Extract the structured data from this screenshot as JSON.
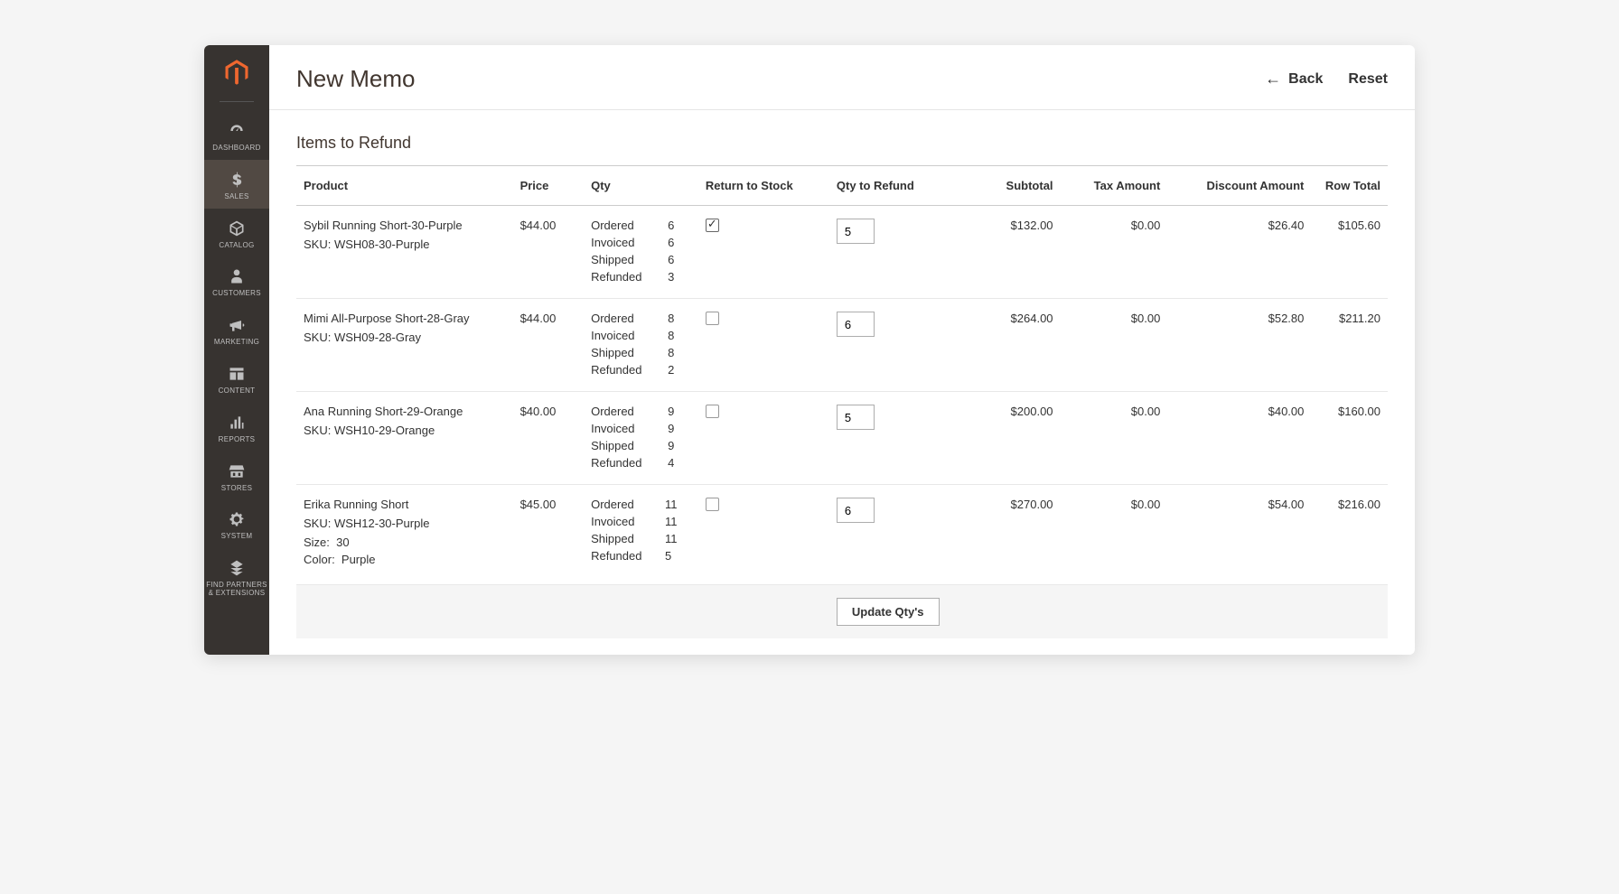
{
  "header": {
    "title": "New Memo",
    "back_label": "Back",
    "reset_label": "Reset"
  },
  "sidebar": {
    "items": [
      {
        "label": "DASHBOARD",
        "icon": "dashboard-icon"
      },
      {
        "label": "SALES",
        "icon": "dollar-icon",
        "active": true
      },
      {
        "label": "CATALOG",
        "icon": "box-icon"
      },
      {
        "label": "CUSTOMERS",
        "icon": "person-icon"
      },
      {
        "label": "MARKETING",
        "icon": "megaphone-icon"
      },
      {
        "label": "CONTENT",
        "icon": "layout-icon"
      },
      {
        "label": "REPORTS",
        "icon": "bars-icon"
      },
      {
        "label": "STORES",
        "icon": "storefront-icon"
      },
      {
        "label": "SYSTEM",
        "icon": "gear-icon"
      },
      {
        "label": "FIND PARTNERS & EXTENSIONS",
        "icon": "grid-icon"
      }
    ]
  },
  "section": {
    "title": "Items to Refund",
    "columns": {
      "product": "Product",
      "price": "Price",
      "qty": "Qty",
      "return_to_stock": "Return to Stock",
      "qty_to_refund": "Qty to Refund",
      "subtotal": "Subtotal",
      "tax_amount": "Tax Amount",
      "discount_amount": "Discount Amount",
      "row_total": "Row Total"
    },
    "qty_labels": {
      "ordered": "Ordered",
      "invoiced": "Invoiced",
      "shipped": "Shipped",
      "refunded": "Refunded"
    },
    "sku_prefix": "SKU:",
    "attr_labels": {
      "size": "Size:",
      "color": "Color:"
    },
    "update_label": "Update Qty's"
  },
  "rows": [
    {
      "name": "Sybil Running Short-30-Purple",
      "sku": "WSH08-30-Purple",
      "price": "$44.00",
      "ordered": "6",
      "invoiced": "6",
      "shipped": "6",
      "refunded": "3",
      "return_checked": true,
      "qty_to_refund": "5",
      "subtotal": "$132.00",
      "tax": "$0.00",
      "discount": "$26.40",
      "row_total": "$105.60"
    },
    {
      "name": "Mimi All-Purpose Short-28-Gray",
      "sku": "WSH09-28-Gray",
      "price": "$44.00",
      "ordered": "8",
      "invoiced": "8",
      "shipped": "8",
      "refunded": "2",
      "return_checked": false,
      "qty_to_refund": "6",
      "subtotal": "$264.00",
      "tax": "$0.00",
      "discount": "$52.80",
      "row_total": "$211.20"
    },
    {
      "name": "Ana Running Short-29-Orange",
      "sku": "WSH10-29-Orange",
      "price": "$40.00",
      "ordered": "9",
      "invoiced": "9",
      "shipped": "9",
      "refunded": "4",
      "return_checked": false,
      "qty_to_refund": "5",
      "subtotal": "$200.00",
      "tax": "$0.00",
      "discount": "$40.00",
      "row_total": "$160.00"
    },
    {
      "name": "Erika Running Short",
      "sku": "WSH12-30-Purple",
      "size": "30",
      "color": "Purple",
      "price": "$45.00",
      "ordered": "11",
      "invoiced": "11",
      "shipped": "11",
      "refunded": "5",
      "return_checked": false,
      "qty_to_refund": "6",
      "subtotal": "$270.00",
      "tax": "$0.00",
      "discount": "$54.00",
      "row_total": "$216.00"
    }
  ]
}
